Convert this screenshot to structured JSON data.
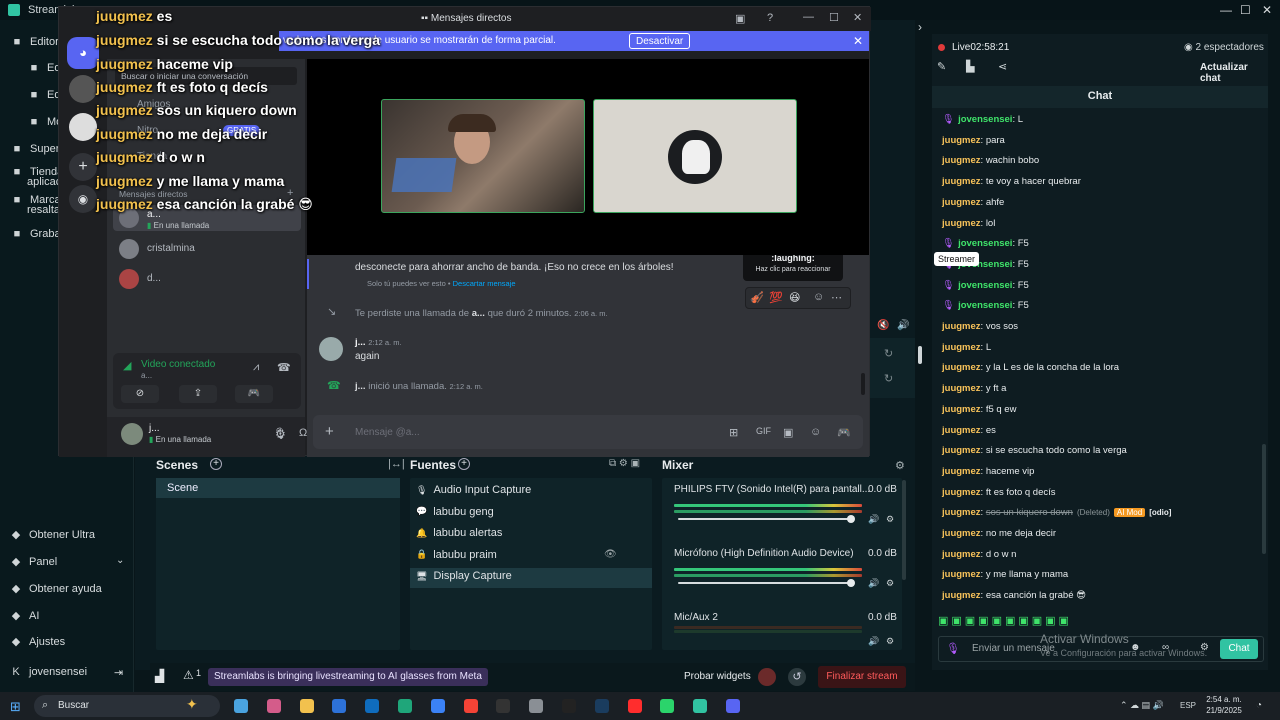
{
  "window": {
    "title": "Streamlabs"
  },
  "sidebar": {
    "top": [
      {
        "label": "Editor",
        "icon": "editor-icon"
      },
      {
        "label": "Edit",
        "icon": "edit-icon"
      },
      {
        "label": "Edit",
        "icon": "edit-icon"
      },
      {
        "label": "Mo",
        "icon": "mode-icon"
      },
      {
        "label": "Superpo",
        "icon": "overlay-icon"
      },
      {
        "label": "Tienda",
        "icon": "store-icon"
      },
      {
        "label": "aplicaci",
        "icon": ""
      },
      {
        "label": "Marcad",
        "icon": "marker-icon"
      },
      {
        "label": "resaltad",
        "icon": ""
      },
      {
        "label": "Grabaci",
        "icon": "record-icon"
      }
    ],
    "bottom": [
      {
        "label": "Obtener Ultra",
        "icon": "ultra-icon"
      },
      {
        "label": "Panel",
        "icon": "panel-icon"
      },
      {
        "label": "Obtener ayuda",
        "icon": "help-icon"
      },
      {
        "label": "AI",
        "icon": "ai-icon"
      },
      {
        "label": "Ajustes",
        "icon": "settings-icon"
      },
      {
        "label": "jovensensei",
        "icon": "user-icon"
      }
    ]
  },
  "discord": {
    "title": "Mensajes directos",
    "banner_text": "vado. Los nombres de usuario se mostrarán de forma parcial.",
    "banner_button": "Desactivar",
    "search_placeholder": "Buscar o iniciar una conversación",
    "friends": "Amigos",
    "nitro": "Nitro",
    "nitro_badge": "GRATIS",
    "shop": "Tienda",
    "dm_header": "Mensajes directos",
    "dms": [
      {
        "name": "a...",
        "status": "En una llamada"
      },
      {
        "name": "cristalmina",
        "status": ""
      },
      {
        "name": "d...",
        "status": ""
      }
    ],
    "voice_status": "Video conectado",
    "voice_sub": "a...",
    "user_name": "j...",
    "user_status": "En una llamada",
    "messages": [
      {
        "text": "desconecte para ahorrar ancho de banda. ¡Eso no crece en los árboles!",
        "sub": "Solo tú puedes ver esto •",
        "link": "Descartar mensaje"
      },
      {
        "text": "Te perdiste una llamada de",
        "bold": "a...",
        "rest": "que duró 2 minutos.",
        "time": "2:06 a. m."
      },
      {
        "name": "j...",
        "time": "2:12 a. m.",
        "text": "again"
      },
      {
        "name": "j...",
        "text": "inició una llamada.",
        "time": "2:12 a. m."
      }
    ],
    "tooltip_title": ":laughing:",
    "tooltip_sub": "Haz clic para reaccionar",
    "message_placeholder": "Mensaje @a..."
  },
  "overlay_chat": [
    {
      "user": "juugmez",
      "text": "es"
    },
    {
      "user": "juugmez",
      "text": "si se escucha todo como la verga"
    },
    {
      "user": "juugmez",
      "text": "haceme vip"
    },
    {
      "user": "juugmez",
      "text": "ft es foto q decís"
    },
    {
      "user": "juugmez",
      "text": "sos un kiquero down"
    },
    {
      "user": "juugmez",
      "text": "no me deja decir"
    },
    {
      "user": "juugmez",
      "text": "d o w n"
    },
    {
      "user": "juugmez",
      "text": "y me llama y mama"
    },
    {
      "user": "juugmez",
      "text": "esa canción la grabé 😎"
    }
  ],
  "obs": {
    "scenes_title": "Scenes",
    "scenes": [
      "Scene"
    ],
    "sources_title": "Fuentes",
    "sources": [
      {
        "label": "Audio Input Capture",
        "icon": "mic-icon"
      },
      {
        "label": "labubu geng",
        "icon": "chat-icon"
      },
      {
        "label": "labubu alertas",
        "icon": "bell-icon"
      },
      {
        "label": "labubu praim",
        "icon": "lock-icon"
      },
      {
        "label": "Display Capture",
        "icon": "monitor-icon"
      }
    ],
    "mixer_title": "Mixer",
    "mixer": [
      {
        "name": "PHILIPS FTV (Sonido Intel(R) para pantall...",
        "db": "0.0 dB"
      },
      {
        "name": "Micrófono (High Definition Audio Device)",
        "db": "0.0 dB"
      },
      {
        "name": "Mic/Aux 2",
        "db": "0.0 dB"
      }
    ],
    "ticker": "Streamlabs is bringing livestreaming to AI glasses from Meta",
    "alerts_count": "1",
    "probar": "Probar widgets",
    "finalizar": "Finalizar stream"
  },
  "right": {
    "live": "Live",
    "time": "02:58:21",
    "viewers": "2 espectadores",
    "refresh": "Actualizar chat",
    "chat_title": "Chat",
    "tooltip": "Streamer",
    "messages": [
      {
        "user": "jovensensei",
        "text": "L",
        "type": "streamer"
      },
      {
        "user": "juugmez",
        "text": "para",
        "type": "user"
      },
      {
        "user": "juugmez",
        "text": "wachin bobo",
        "type": "user"
      },
      {
        "user": "juugmez",
        "text": "te voy a hacer quebrar",
        "type": "user"
      },
      {
        "user": "juugmez",
        "text": "ahfe",
        "type": "user"
      },
      {
        "user": "juugmez",
        "text": "lol",
        "type": "user"
      },
      {
        "user": "jovensensei",
        "text": "F5",
        "type": "streamer"
      },
      {
        "user": "jovensensei",
        "text": "F5",
        "type": "streamer"
      },
      {
        "user": "jovensensei",
        "text": "F5",
        "type": "streamer"
      },
      {
        "user": "jovensensei",
        "text": "F5",
        "type": "streamer"
      },
      {
        "user": "juugmez",
        "text": "vos sos",
        "type": "user"
      },
      {
        "user": "juugmez",
        "text": "L",
        "type": "user"
      },
      {
        "user": "juugmez",
        "text": "y la L es de la concha de la lora",
        "type": "user"
      },
      {
        "user": "juugmez",
        "text": "y ft a",
        "type": "user"
      },
      {
        "user": "juugmez",
        "text": "f5 q ew",
        "type": "user"
      },
      {
        "user": "juugmez",
        "text": "es",
        "type": "user"
      },
      {
        "user": "juugmez",
        "text": "si se escucha todo como la verga",
        "type": "user"
      },
      {
        "user": "juugmez",
        "text": "haceme vip",
        "type": "user"
      },
      {
        "user": "juugmez",
        "text": "ft es foto q decís",
        "type": "user"
      },
      {
        "user": "juugmez",
        "text": "sos un kiquero down",
        "type": "deleted",
        "deleted": "(Deleted)",
        "badge": "AI Mod",
        "tag": "[odio]"
      },
      {
        "user": "juugmez",
        "text": "no me deja decir",
        "type": "user"
      },
      {
        "user": "juugmez",
        "text": "d o w n",
        "type": "user"
      },
      {
        "user": "juugmez",
        "text": "y me llama y mama",
        "type": "user"
      },
      {
        "user": "juugmez",
        "text": "esa canción la grabé 😎",
        "type": "user"
      }
    ],
    "input_placeholder": "Enviar un mensaje",
    "send": "Chat",
    "watermark1": "Activar Windows",
    "watermark2": "Ve a Configuración para activar Windows."
  },
  "taskbar": {
    "search": "Buscar",
    "lang": "ESP",
    "time": "2:54 a. m.",
    "date": "21/9/2025"
  },
  "colors": {
    "accent": "#31c3a2",
    "discord": "#5865f2",
    "live": "#e03a3a",
    "user": "#f7c25a",
    "streamer": "#3fe36a"
  }
}
